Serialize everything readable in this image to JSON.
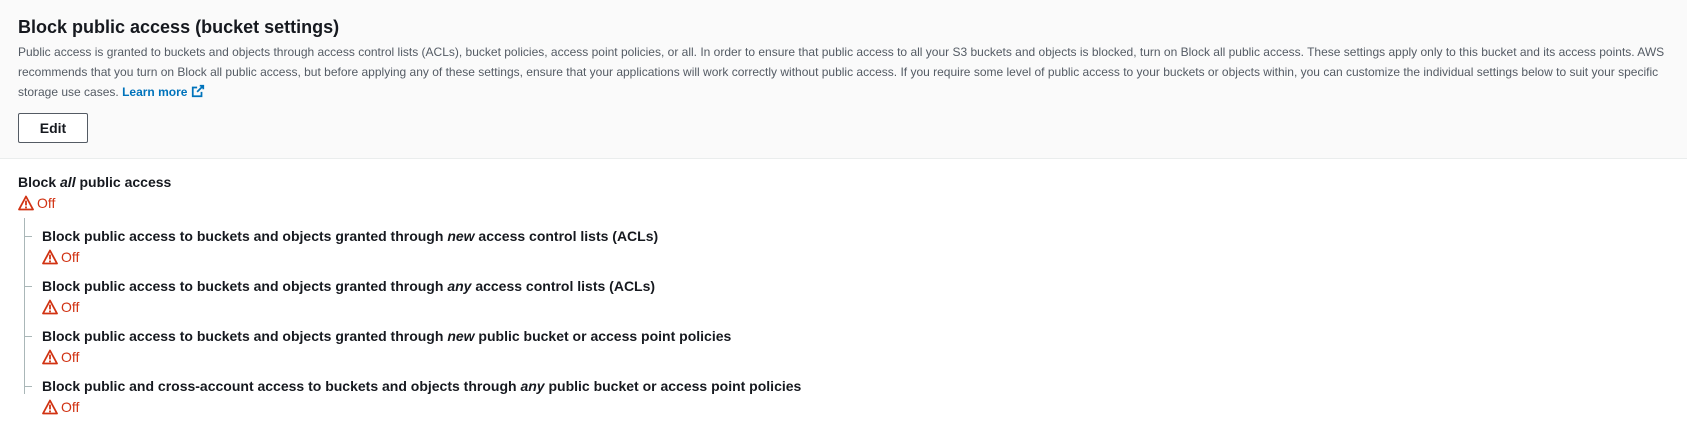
{
  "header": {
    "title": "Block public access (bucket settings)",
    "description": "Public access is granted to buckets and objects through access control lists (ACLs), bucket policies, access point policies, or all. In order to ensure that public access to all your S3 buckets and objects is blocked, turn on Block all public access. These settings apply only to this bucket and its access points. AWS recommends that you turn on Block all public access, but before applying any of these settings, ensure that your applications will work correctly without public access. If you require some level of public access to your buckets or objects within, you can customize the individual settings below to suit your specific storage use cases.",
    "learn_more": "Learn more",
    "edit_label": "Edit"
  },
  "main_setting": {
    "title_pre": "Block ",
    "title_em": "all",
    "title_post": " public access",
    "status": "Off"
  },
  "sub_settings": [
    {
      "title_pre": "Block public access to buckets and objects granted through ",
      "title_em": "new",
      "title_post": " access control lists (ACLs)",
      "status": "Off"
    },
    {
      "title_pre": "Block public access to buckets and objects granted through ",
      "title_em": "any",
      "title_post": " access control lists (ACLs)",
      "status": "Off"
    },
    {
      "title_pre": "Block public access to buckets and objects granted through ",
      "title_em": "new",
      "title_post": " public bucket or access point policies",
      "status": "Off"
    },
    {
      "title_pre": "Block public and cross-account access to buckets and objects through ",
      "title_em": "any",
      "title_post": " public bucket or access point policies",
      "status": "Off"
    }
  ],
  "colors": {
    "warning": "#d13212",
    "link": "#0073bb",
    "text": "#16191f",
    "secondary_text": "#545b64",
    "header_bg": "#fafafa"
  },
  "icons": {
    "warning": "warning-icon",
    "external_link": "external-link-icon"
  }
}
